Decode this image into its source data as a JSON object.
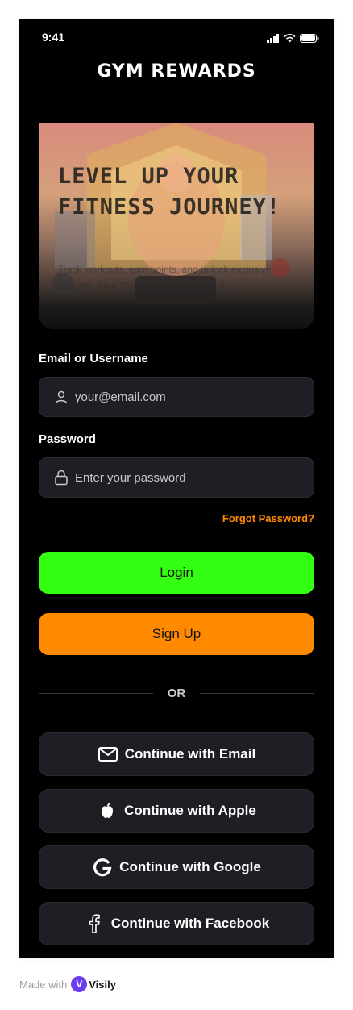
{
  "status_bar": {
    "time": "9:41"
  },
  "app": {
    "title": "GYM REWARDS"
  },
  "hero": {
    "headline": "LEVEL UP YOUR FITNESS JOURNEY!",
    "subtext": "Track workouts, earn points, and unlock exclusive rewards. Your fitness journey starts here."
  },
  "form": {
    "email_label": "Email or Username",
    "email_placeholder": "your@email.com",
    "password_label": "Password",
    "password_placeholder": "Enter your password",
    "forgot_label": "Forgot Password?"
  },
  "actions": {
    "login_label": "Login",
    "signup_label": "Sign Up",
    "divider_text": "OR"
  },
  "social": [
    {
      "label": "Continue with Email",
      "icon": "mail-icon"
    },
    {
      "label": "Continue with Apple",
      "icon": "apple-icon"
    },
    {
      "label": "Continue with Google",
      "icon": "google-icon"
    },
    {
      "label": "Continue with Facebook",
      "icon": "facebook-icon"
    }
  ],
  "footer": {
    "made_with": "Made with",
    "brand": "Visily"
  },
  "colors": {
    "background": "#000000",
    "login": "#33ff12",
    "signup": "#ff8a00",
    "accent": "#ff8a00",
    "input_bg": "#1e1f24"
  }
}
